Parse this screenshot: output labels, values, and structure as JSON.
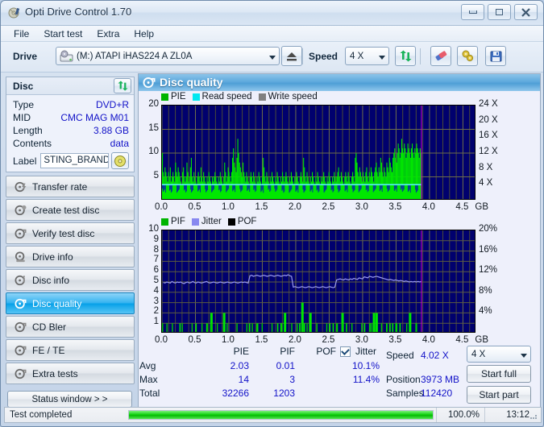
{
  "window": {
    "title": "Opti Drive Control 1.70",
    "icon": "disc-icon",
    "buttons": {
      "minimize": "minimize-icon",
      "maximize": "maximize-icon",
      "close": "close-icon"
    }
  },
  "menu": {
    "items": [
      "File",
      "Start test",
      "Extra",
      "Help"
    ]
  },
  "toolbar": {
    "drive_label": "Drive",
    "drive_value": "(M:)  ATAPI iHAS224  A ZL0A",
    "eject_icon": "eject-icon",
    "speed_label": "Speed",
    "speed_value": "4 X",
    "refresh_icon": "refresh-icon",
    "erase_icon": "eraser-icon",
    "settings_icon": "settings-icon",
    "save_icon": "save-icon"
  },
  "disc_panel": {
    "title": "Disc",
    "refresh_icon": "refresh-icon",
    "rows": [
      {
        "key": "Type",
        "value": "DVD+R"
      },
      {
        "key": "MID",
        "value": "CMC MAG M01"
      },
      {
        "key": "Length",
        "value": "3.88 GB"
      },
      {
        "key": "Contents",
        "value": "data"
      }
    ],
    "label_key": "Label",
    "label_value": "STING_BRAND",
    "label_btn_icon": "disc-icon"
  },
  "sidebar": {
    "items": [
      {
        "label": "Transfer rate",
        "icon": "disc-speed-icon",
        "selected": false
      },
      {
        "label": "Create test disc",
        "icon": "disc-write-icon",
        "selected": false
      },
      {
        "label": "Verify test disc",
        "icon": "disc-verify-icon",
        "selected": false
      },
      {
        "label": "Drive info",
        "icon": "drive-info-icon",
        "selected": false
      },
      {
        "label": "Disc info",
        "icon": "disc-info-icon",
        "selected": false
      },
      {
        "label": "Disc quality",
        "icon": "disc-quality-icon",
        "selected": true
      },
      {
        "label": "CD Bler",
        "icon": "disc-bler-icon",
        "selected": false
      },
      {
        "label": "FE / TE",
        "icon": "disc-fete-icon",
        "selected": false
      },
      {
        "label": "Extra tests",
        "icon": "disc-extra-icon",
        "selected": false
      }
    ],
    "status_window_button": "Status window > >"
  },
  "content": {
    "title": "Disc quality",
    "icon": "disc-quality-icon"
  },
  "chart_data": [
    {
      "type": "bar",
      "name": "pie-chart",
      "title": "",
      "legend": [
        {
          "label": "PIE",
          "color": "#00b400"
        },
        {
          "label": "Read speed",
          "color": "#00e8f0"
        },
        {
          "label": "Write speed",
          "color": "#808080"
        }
      ],
      "legend_position": "top-left",
      "grid": true,
      "xlabel": "GB",
      "x_ticks": [
        "0.0",
        "0.5",
        "1.0",
        "1.5",
        "2.0",
        "2.5",
        "3.0",
        "3.5",
        "4.0",
        "4.5"
      ],
      "xlim": [
        0,
        4.7
      ],
      "ylabel_left": "PIE",
      "y_ticks_left": [
        "5",
        "10",
        "15",
        "20"
      ],
      "ylim_left": [
        0,
        20
      ],
      "ylabel_right": "speed",
      "y_ticks_right": [
        "4 X",
        "8 X",
        "12 X",
        "16 X",
        "20 X",
        "24 X"
      ],
      "ylim_right": [
        0,
        24
      ],
      "plot_bg": "#00006e",
      "scan_end_gb": 3.88,
      "read_speed_line_x": 4.02,
      "series": [
        {
          "name": "PIE",
          "color": "#00e800",
          "x_start": 0.0,
          "x_end": 3.88,
          "values": [
            10,
            6,
            5,
            7,
            6,
            5,
            4,
            6,
            5,
            7,
            4,
            5,
            6,
            5,
            4,
            8,
            6,
            5,
            7,
            6,
            5,
            4,
            3,
            6,
            7,
            5,
            4,
            5,
            8,
            6,
            4,
            5,
            7,
            9,
            5,
            4,
            6,
            5,
            4,
            3,
            5,
            6,
            5,
            4,
            7,
            5,
            4,
            6,
            5,
            4,
            3,
            5,
            4,
            6,
            5,
            4,
            3,
            5,
            4,
            5,
            6,
            5,
            4,
            3,
            5,
            4,
            6,
            5,
            4,
            3,
            5,
            8,
            6,
            4,
            5,
            7,
            6,
            5,
            4,
            6,
            9,
            11,
            8,
            7,
            6,
            9,
            13,
            10,
            8,
            7,
            6,
            5,
            8,
            6,
            5,
            4,
            6,
            5,
            4,
            3,
            5,
            6,
            5,
            4,
            6,
            5,
            4,
            3,
            5,
            4,
            6,
            5,
            4,
            3,
            5,
            9,
            7,
            5,
            4,
            6,
            5,
            4,
            3,
            5,
            4,
            6,
            5,
            4,
            3,
            5,
            4,
            6,
            5,
            4,
            3,
            5,
            4,
            6,
            5,
            4,
            5,
            6,
            5,
            4,
            3,
            5,
            4,
            6,
            5,
            4,
            3,
            5,
            4,
            6,
            5,
            4,
            3,
            5,
            6,
            5,
            4,
            9,
            7,
            5,
            4,
            6,
            5,
            4,
            3,
            5,
            4,
            6,
            5,
            4,
            3,
            5,
            4,
            6,
            5,
            4,
            3,
            5,
            4,
            5,
            6,
            5,
            4,
            3,
            5,
            4,
            6,
            5,
            4,
            3,
            5,
            4,
            6,
            5,
            4,
            5,
            6,
            7,
            5,
            4,
            6,
            5,
            4,
            3,
            5,
            6,
            5,
            4,
            6,
            5,
            4,
            3,
            5,
            6,
            5,
            4,
            9,
            10,
            8,
            6,
            5,
            7,
            6,
            5,
            4,
            6,
            5,
            4,
            6,
            7,
            5,
            4,
            6,
            5,
            7,
            6,
            5,
            4,
            6,
            7,
            8,
            6,
            5,
            7,
            6,
            9,
            8,
            6,
            5,
            7,
            6,
            5,
            8,
            7,
            6,
            9,
            8,
            7,
            6,
            9,
            10,
            11,
            9,
            8,
            10,
            12,
            11,
            9,
            10,
            13,
            11,
            10,
            12,
            11,
            9,
            10,
            12,
            11,
            10,
            9,
            11,
            12,
            10,
            9,
            11,
            10,
            12,
            11,
            10,
            9,
            11,
            10
          ]
        },
        {
          "name": "Read speed",
          "color": "#40ecec",
          "constant_value_x": 4.02,
          "note": "flat cyan line near 4X across scanned range"
        }
      ]
    },
    {
      "type": "bar",
      "name": "pif-jitter-chart",
      "title": "",
      "legend": [
        {
          "label": "PIF",
          "color": "#00b400"
        },
        {
          "label": "Jitter",
          "color": "#8888f0"
        },
        {
          "label": "POF",
          "color": "#000000"
        }
      ],
      "legend_position": "top-left",
      "grid": true,
      "xlabel": "GB",
      "x_ticks": [
        "0.0",
        "0.5",
        "1.0",
        "1.5",
        "2.0",
        "2.5",
        "3.0",
        "3.5",
        "4.0",
        "4.5"
      ],
      "xlim": [
        0,
        4.7
      ],
      "ylabel_left": "PIF",
      "y_ticks_left": [
        "1",
        "2",
        "3",
        "4",
        "5",
        "6",
        "7",
        "8",
        "9",
        "10"
      ],
      "ylim_left": [
        0,
        10
      ],
      "ylabel_right": "Jitter",
      "y_ticks_right": [
        "4%",
        "8%",
        "12%",
        "16%",
        "20%"
      ],
      "ylim_right": [
        0,
        20
      ],
      "plot_bg": "#00006e",
      "scan_end_gb": 3.88,
      "series": [
        {
          "name": "PIF",
          "color": "#00e800",
          "spikes": [
            {
              "x": 0.27,
              "y": 1
            },
            {
              "x": 0.51,
              "y": 1
            },
            {
              "x": 0.67,
              "y": 1
            },
            {
              "x": 0.74,
              "y": 2
            },
            {
              "x": 0.93,
              "y": 2
            },
            {
              "x": 1.31,
              "y": 1
            },
            {
              "x": 1.43,
              "y": 1
            },
            {
              "x": 1.73,
              "y": 1
            },
            {
              "x": 1.78,
              "y": 1
            },
            {
              "x": 1.84,
              "y": 2
            },
            {
              "x": 2.06,
              "y": 1
            },
            {
              "x": 2.1,
              "y": 3
            },
            {
              "x": 2.13,
              "y": 1
            },
            {
              "x": 2.22,
              "y": 2
            },
            {
              "x": 2.51,
              "y": 1
            },
            {
              "x": 2.56,
              "y": 1
            },
            {
              "x": 2.62,
              "y": 1
            },
            {
              "x": 2.7,
              "y": 2
            },
            {
              "x": 2.76,
              "y": 1
            },
            {
              "x": 3.03,
              "y": 1
            },
            {
              "x": 3.11,
              "y": 1
            },
            {
              "x": 3.17,
              "y": 2
            },
            {
              "x": 3.21,
              "y": 2
            },
            {
              "x": 3.36,
              "y": 1
            },
            {
              "x": 3.41,
              "y": 1
            },
            {
              "x": 3.45,
              "y": 1
            },
            {
              "x": 3.5,
              "y": 1
            },
            {
              "x": 3.56,
              "y": 1
            },
            {
              "x": 3.71,
              "y": 2
            },
            {
              "x": 3.8,
              "y": 1
            }
          ]
        },
        {
          "name": "Jitter",
          "color": "#9a9aee",
          "percent_values": [
            9.9,
            9.8,
            10.0,
            9.9,
            9.8,
            10.1,
            9.9,
            9.8,
            10.0,
            9.9,
            10.0,
            9.8,
            9.7,
            9.9,
            10.0,
            9.8,
            9.9,
            10.1,
            9.9,
            9.8,
            10.0,
            9.9,
            9.8,
            9.9,
            10.0,
            10.1,
            9.9,
            9.8,
            9.9,
            10.0,
            9.9,
            9.8,
            9.9,
            10.0,
            9.9,
            9.8,
            9.9,
            10.0,
            9.9,
            9.8,
            9.9,
            10.0,
            9.9,
            9.8,
            9.9,
            10.0,
            9.9,
            10.0,
            9.9,
            9.8,
            11.2,
            11.3,
            11.1,
            11.2,
            11.3,
            11.2,
            11.1,
            11.2,
            11.3,
            11.2,
            11.1,
            11.2,
            11.3,
            11.2,
            11.1,
            11.2,
            11.3,
            11.2,
            11.1,
            11.2,
            11.3,
            11.2,
            11.4,
            11.2,
            11.1,
            9.0,
            9.1,
            9.0,
            8.9,
            9.0,
            9.1,
            9.0,
            8.9,
            9.0,
            9.1,
            9.0,
            8.9,
            9.0,
            9.1,
            9.0,
            8.9,
            9.0,
            9.1,
            9.0,
            8.9,
            9.0,
            9.1,
            9.0,
            8.9,
            9.0,
            10.4,
            10.5,
            10.6,
            10.5,
            10.4,
            10.6,
            10.5,
            10.4,
            10.6,
            10.5,
            10.7,
            10.6,
            10.5,
            10.8,
            10.7,
            10.6,
            11.0,
            10.9,
            10.8,
            11.1,
            11.0,
            10.9,
            11.0,
            11.1,
            11.0,
            10.9,
            10.8,
            10.7,
            10.6,
            10.5,
            10.4,
            10.5,
            10.4,
            10.3,
            10.4,
            10.3,
            10.2,
            10.3,
            10.2,
            10.1,
            10.2,
            10.1,
            10.0,
            10.1,
            10.0,
            10.1,
            10.0,
            10.1,
            10.0,
            10.1
          ]
        }
      ]
    }
  ],
  "stats": {
    "columns": [
      "PIE",
      "PIF",
      "POF",
      "Jitter"
    ],
    "jitter_checked": true,
    "rows": [
      {
        "label": "Avg",
        "PIE": "2.03",
        "PIF": "0.01",
        "POF": "",
        "Jitter": "10.1%"
      },
      {
        "label": "Max",
        "PIE": "14",
        "PIF": "3",
        "POF": "",
        "Jitter": "11.4%"
      },
      {
        "label": "Total",
        "PIE": "32266",
        "PIF": "1203",
        "POF": "",
        "Jitter": ""
      }
    ]
  },
  "results": {
    "speed_key": "Speed",
    "speed_value": "4.02 X",
    "position_key": "Position",
    "position_value": "3973 MB",
    "samples_key": "Samples",
    "samples_value": "112420",
    "speed_select": "4 X",
    "start_full_button": "Start full",
    "start_part_button": "Start part"
  },
  "statusbar": {
    "message": "Test completed",
    "progress_percent": 100.0,
    "percent_text": "100.0%",
    "time": "13:12"
  }
}
